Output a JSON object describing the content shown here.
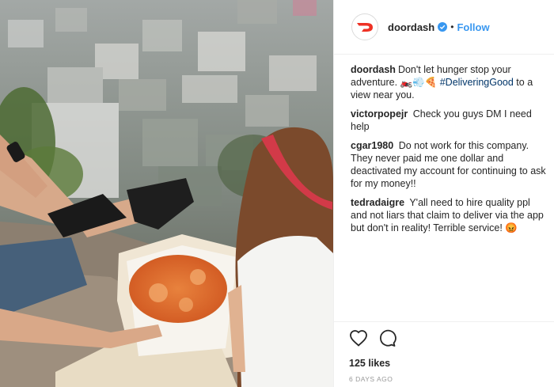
{
  "post": {
    "username": "doordash",
    "follow_label": "Follow",
    "separator": "•",
    "verified_icon": "verified-badge-icon",
    "avatar_icon": "doordash-logo-icon",
    "brand_color": "#ee3124",
    "caption": {
      "user": "doordash",
      "text_before": "Don't let hunger stop your adventure. 🏍️💨🍕 ",
      "hashtag": "#DeliveringGood",
      "text_after": " to a view near you."
    },
    "comments": [
      {
        "user": "victorpopejr",
        "text": "Check you guys DM I need help"
      },
      {
        "user": "cgar1980",
        "text": "Do not work for this company. They never paid me one dollar and deactivated my account for continuing to ask for my money!!"
      },
      {
        "user": "tedradaigre",
        "text": "Y'all need to hire quality ppl and not liars that claim to deliver via the app but don't in reality! Terrible service! 😡"
      }
    ],
    "likes": "125 likes",
    "timestamp": "6 DAYS AGO"
  },
  "icons": {
    "like": "heart-icon",
    "comment": "comment-bubble-icon"
  },
  "colors": {
    "link": "#3897f0",
    "hashtag": "#003569",
    "muted": "#999999"
  }
}
